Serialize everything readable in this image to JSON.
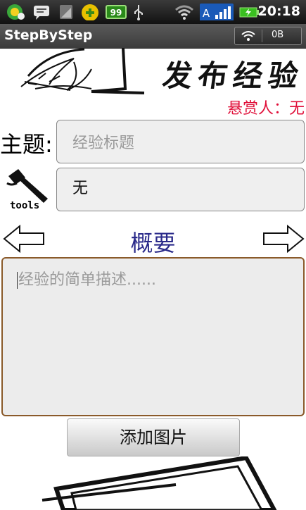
{
  "status_bar": {
    "time": "20:18",
    "battery_badge": "99",
    "network_badge": "A"
  },
  "app": {
    "title": "StepByStep",
    "traffic": "0B"
  },
  "banner": {
    "title": "发布经验"
  },
  "reward": {
    "text": "悬赏人：无"
  },
  "form": {
    "topic_label": "主题:",
    "title_placeholder": "经验标题",
    "tools_label": "tools",
    "tools_value": "无",
    "summary_label": "概要",
    "description_placeholder": "经验的简单描述......",
    "add_image_label": "添加图片"
  }
}
